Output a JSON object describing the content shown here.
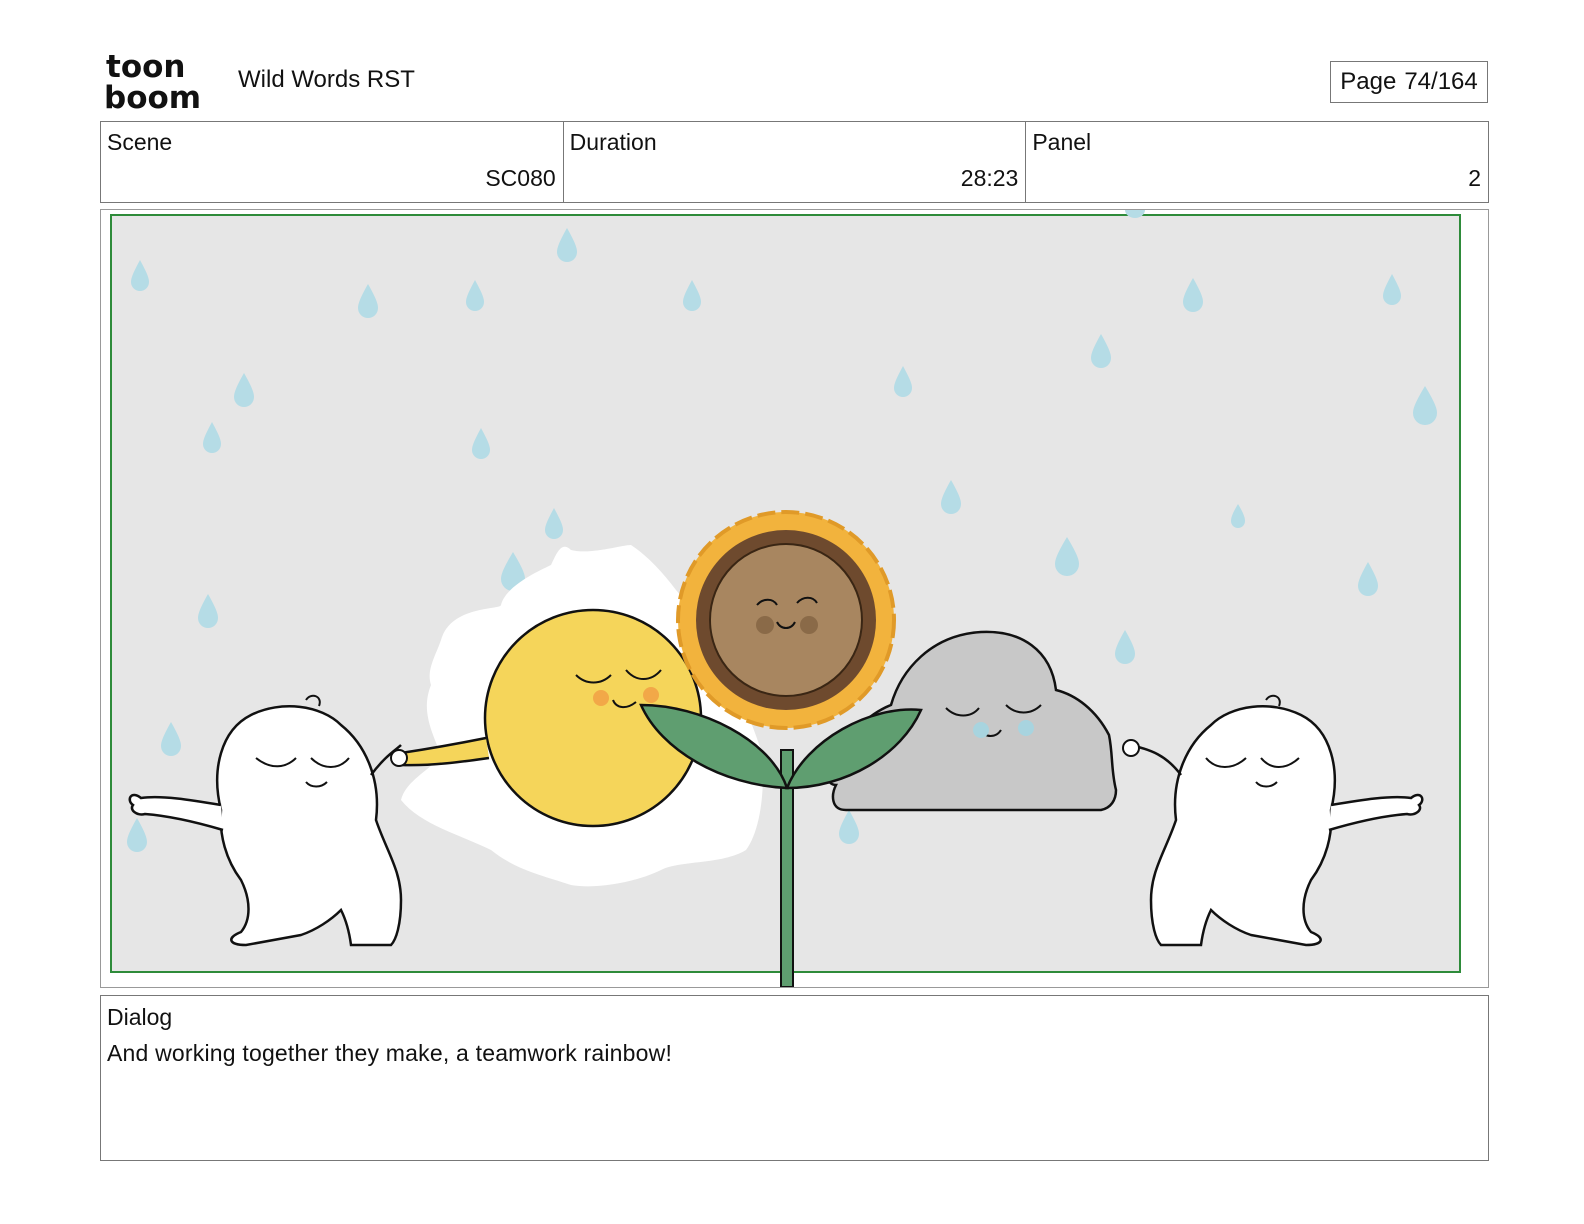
{
  "header": {
    "logo_line1": "toon",
    "logo_line2": "boom",
    "project_title": "Wild Words RST",
    "page_label": "Page",
    "page_number": "74/164"
  },
  "info": {
    "scene_label": "Scene",
    "scene_value": "SC080",
    "duration_label": "Duration",
    "duration_value": "28:23",
    "panel_label": "Panel",
    "panel_value": "2"
  },
  "artwork": {
    "background_color": "#e6e6e6",
    "frame_color": "#2e8b3a",
    "raindrop_color": "#b5dce6",
    "sun_color": "#f5d55a",
    "sunflower_petal_color": "#f2b33d",
    "sunflower_center_color": "#a88660",
    "leaf_color": "#5f9e70",
    "cloud_color": "#c8c8c8",
    "characters": [
      "left-blob-character",
      "sun-character",
      "sunflower-character",
      "cloud-character",
      "right-blob-character"
    ]
  },
  "dialog": {
    "label": "Dialog",
    "text": "And working together they make, a teamwork rainbow!"
  }
}
